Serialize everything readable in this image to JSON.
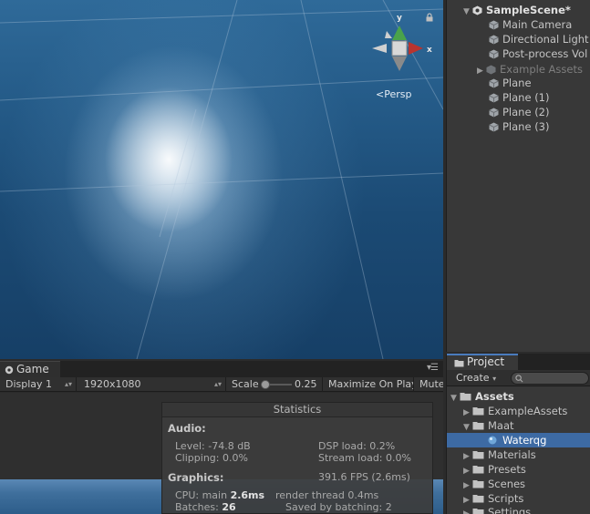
{
  "scene_view": {
    "persp_label": "Persp",
    "gizmo_axes": {
      "y": "y",
      "x": "x"
    },
    "icons": {
      "gizmo": "axis-gizmo-icon",
      "lock": "lock-icon",
      "persp": "persp-arrow-icon"
    }
  },
  "hierarchy": {
    "scene_name": "SampleScene*",
    "items": [
      {
        "label": "Main Camera"
      },
      {
        "label": "Directional Light"
      },
      {
        "label": "Post-process Vol"
      },
      {
        "label": "Example Assets"
      },
      {
        "label": "Plane"
      },
      {
        "label": "Plane (1)"
      },
      {
        "label": "Plane (2)"
      },
      {
        "label": "Plane (3)"
      }
    ]
  },
  "game": {
    "tab_label": "Game",
    "display": "Display 1",
    "resolution": "1920x1080",
    "scale_label": "Scale",
    "scale_value": "0.25",
    "maximize": "Maximize On Play",
    "mute": "Mute"
  },
  "statistics": {
    "title": "Statistics",
    "audio_header": "Audio:",
    "level": "Level: -74.8 dB",
    "dsp_load": "DSP load: 0.2%",
    "clipping": "Clipping: 0.0%",
    "stream_load": "Stream load: 0.0%",
    "graphics_header": "Graphics:",
    "fps": "391.6 FPS (2.6ms)",
    "cpu_label": "CPU: main",
    "cpu_main": "2.6ms",
    "render_thread": "render thread 0.4ms",
    "batches_label": "Batches:",
    "batches_value": "26",
    "saved_batching": "Saved by batching: 2"
  },
  "project": {
    "tab_label": "Project",
    "create_label": "Create",
    "search_placeholder": "",
    "tree": [
      {
        "label": "Assets"
      },
      {
        "label": "ExampleAssets"
      },
      {
        "label": "Maat"
      },
      {
        "label": "Waterqg"
      },
      {
        "label": "Materials"
      },
      {
        "label": "Presets"
      },
      {
        "label": "Scenes"
      },
      {
        "label": "Scripts"
      },
      {
        "label": "Settings"
      }
    ]
  },
  "colors": {
    "selection": "#3d6aa3",
    "gizmo_y": "#4aa34a",
    "gizmo_x": "#b8342f",
    "water": "#1f5283"
  }
}
